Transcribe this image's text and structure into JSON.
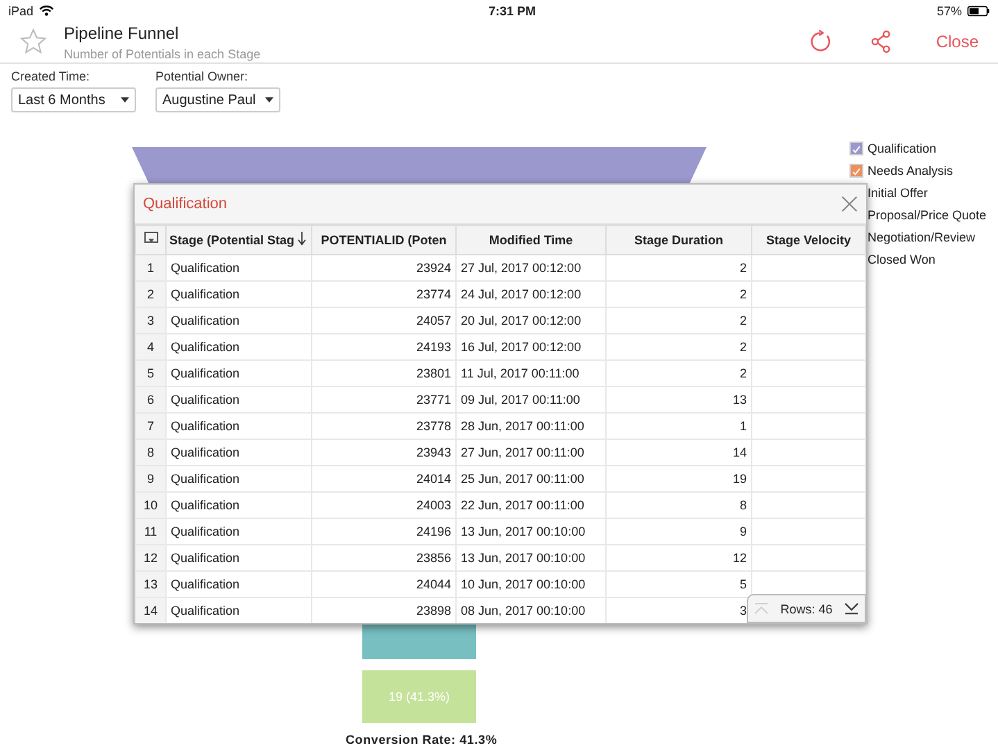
{
  "status_bar": {
    "device": "iPad",
    "time": "7:31 PM",
    "battery": "57%"
  },
  "header": {
    "title": "Pipeline Funnel",
    "subtitle": "Number of Potentials in each Stage",
    "close": "Close"
  },
  "filters": [
    {
      "label": "Created Time:",
      "value": "Last 6 Months"
    },
    {
      "label": "Potential Owner:",
      "value": "Augustine Paul"
    }
  ],
  "funnel": {
    "last_label": "19 (41.3%)",
    "conversion": "Conversion Rate: 41.3%"
  },
  "legend": [
    {
      "label": "Qualification",
      "checked": true,
      "color": "#9a98cc"
    },
    {
      "label": "Needs Analysis",
      "checked": true,
      "color": "#ef8f5b"
    },
    {
      "label": "Initial Offer"
    },
    {
      "label": "Proposal/Price Quote"
    },
    {
      "label": "Negotiation/Review"
    },
    {
      "label": "Closed Won"
    }
  ],
  "dialog": {
    "title": "Qualification",
    "columns": [
      "",
      "Stage (Potential Stag",
      "POTENTIALID (Poten",
      "Modified Time",
      "Stage Duration",
      "Stage Velocity"
    ],
    "rows": [
      [
        "1",
        "Qualification",
        "23924",
        "27 Jul, 2017 00:12:00",
        "2"
      ],
      [
        "2",
        "Qualification",
        "23774",
        "24 Jul, 2017 00:12:00",
        "2"
      ],
      [
        "3",
        "Qualification",
        "24057",
        "20 Jul, 2017 00:12:00",
        "2"
      ],
      [
        "4",
        "Qualification",
        "24193",
        "16 Jul, 2017 00:12:00",
        "2"
      ],
      [
        "5",
        "Qualification",
        "23801",
        "11 Jul, 2017 00:11:00",
        "2"
      ],
      [
        "6",
        "Qualification",
        "23771",
        "09 Jul, 2017 00:11:00",
        "13"
      ],
      [
        "7",
        "Qualification",
        "23778",
        "28 Jun, 2017 00:11:00",
        "1"
      ],
      [
        "8",
        "Qualification",
        "23943",
        "27 Jun, 2017 00:11:00",
        "14"
      ],
      [
        "9",
        "Qualification",
        "24014",
        "25 Jun, 2017 00:11:00",
        "19"
      ],
      [
        "10",
        "Qualification",
        "24003",
        "22 Jun, 2017 00:11:00",
        "8"
      ],
      [
        "11",
        "Qualification",
        "24196",
        "13 Jun, 2017 00:10:00",
        "9"
      ],
      [
        "12",
        "Qualification",
        "23856",
        "13 Jun, 2017 00:10:00",
        "12"
      ],
      [
        "13",
        "Qualification",
        "24044",
        "10 Jun, 2017 00:10:00",
        "5"
      ],
      [
        "14",
        "Qualification",
        "23898",
        "08 Jun, 2017 00:10:00",
        "3"
      ]
    ],
    "rows_count": "Rows: 46"
  }
}
